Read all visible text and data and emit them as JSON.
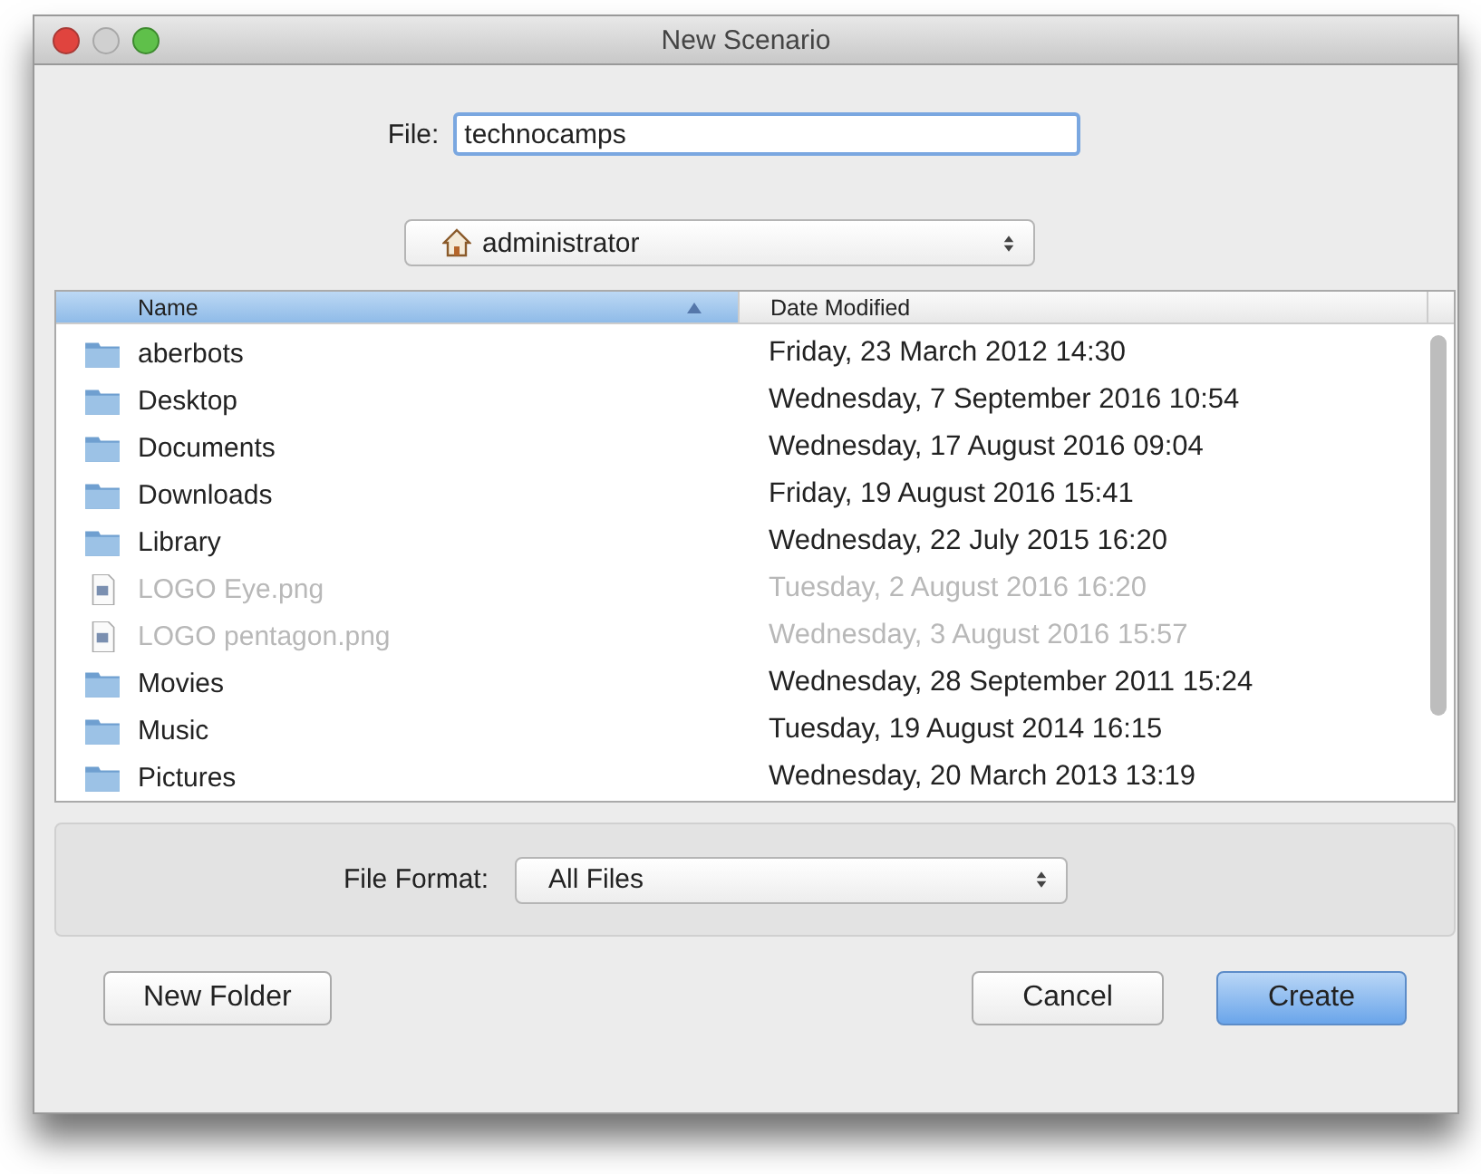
{
  "window": {
    "title": "New Scenario"
  },
  "file_field": {
    "label": "File:",
    "value": "technocamps"
  },
  "location": {
    "value": "administrator"
  },
  "table": {
    "columns": [
      {
        "label": "Name",
        "selected": true,
        "sorted": true
      },
      {
        "label": "Date Modified",
        "selected": false
      }
    ],
    "rows": [
      {
        "kind": "folder",
        "name": "aberbots",
        "date": "Friday, 23 March 2012 14:30",
        "disabled": false
      },
      {
        "kind": "folder",
        "name": "Desktop",
        "date": "Wednesday, 7 September 2016 10:54",
        "disabled": false
      },
      {
        "kind": "folder",
        "name": "Documents",
        "date": "Wednesday, 17 August 2016 09:04",
        "disabled": false
      },
      {
        "kind": "folder",
        "name": "Downloads",
        "date": "Friday, 19 August 2016 15:41",
        "disabled": false
      },
      {
        "kind": "folder",
        "name": "Library",
        "date": "Wednesday, 22 July 2015 16:20",
        "disabled": false
      },
      {
        "kind": "file",
        "name": "LOGO Eye.png",
        "date": "Tuesday, 2 August 2016 16:20",
        "disabled": true
      },
      {
        "kind": "file",
        "name": "LOGO pentagon.png",
        "date": "Wednesday, 3 August 2016 15:57",
        "disabled": true
      },
      {
        "kind": "folder",
        "name": "Movies",
        "date": "Wednesday, 28 September 2011 15:24",
        "disabled": false
      },
      {
        "kind": "folder",
        "name": "Music",
        "date": "Tuesday, 19 August 2014 16:15",
        "disabled": false
      },
      {
        "kind": "folder",
        "name": "Pictures",
        "date": "Wednesday, 20 March 2013 13:19",
        "disabled": false
      }
    ]
  },
  "file_format": {
    "label": "File Format:",
    "value": "All Files"
  },
  "buttons": [
    {
      "label": "New Folder",
      "default": false
    },
    {
      "label": "Cancel",
      "default": false
    },
    {
      "label": "Create",
      "default": true
    }
  ]
}
